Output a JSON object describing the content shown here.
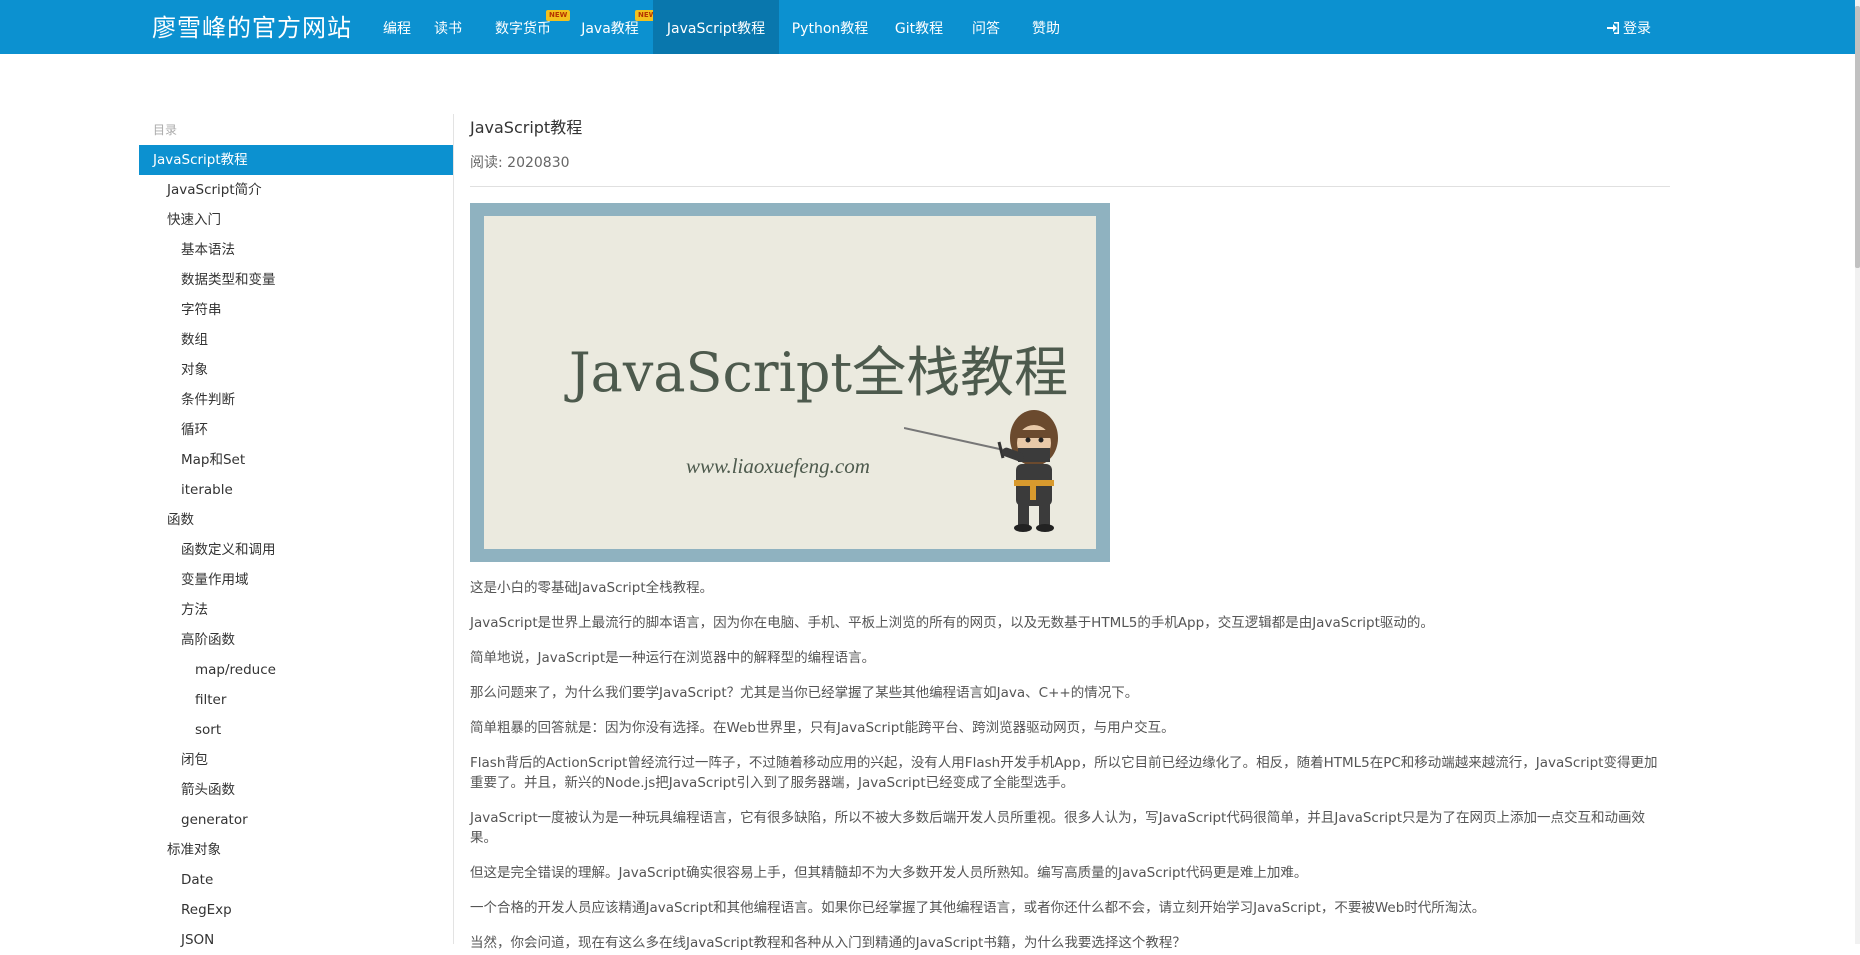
{
  "nav": {
    "brand": "廖雪峰的官方网站",
    "items": [
      {
        "label": "编程",
        "badge": ""
      },
      {
        "label": "读书",
        "badge": ""
      },
      {
        "label": "数字货币",
        "badge": "NEW"
      },
      {
        "label": "Java教程",
        "badge": "NEW"
      },
      {
        "label": "JavaScript教程",
        "badge": ""
      },
      {
        "label": "Python教程",
        "badge": ""
      },
      {
        "label": "Git教程",
        "badge": ""
      },
      {
        "label": "问答",
        "badge": ""
      },
      {
        "label": "赞助",
        "badge": ""
      }
    ],
    "active_item": "JavaScript教程",
    "login_label": "登录",
    "login_icon": "sign-in-icon"
  },
  "sidebar": {
    "header": "目录",
    "items": [
      {
        "label": "JavaScript教程",
        "level": 0,
        "active": true
      },
      {
        "label": "JavaScript简介",
        "level": 1
      },
      {
        "label": "快速入门",
        "level": 1
      },
      {
        "label": "基本语法",
        "level": 2
      },
      {
        "label": "数据类型和变量",
        "level": 2
      },
      {
        "label": "字符串",
        "level": 2
      },
      {
        "label": "数组",
        "level": 2
      },
      {
        "label": "对象",
        "level": 2
      },
      {
        "label": "条件判断",
        "level": 2
      },
      {
        "label": "循环",
        "level": 2
      },
      {
        "label": "Map和Set",
        "level": 2
      },
      {
        "label": "iterable",
        "level": 2
      },
      {
        "label": "函数",
        "level": 1
      },
      {
        "label": "函数定义和调用",
        "level": 2
      },
      {
        "label": "变量作用域",
        "level": 2
      },
      {
        "label": "方法",
        "level": 2
      },
      {
        "label": "高阶函数",
        "level": 2
      },
      {
        "label": "map/reduce",
        "level": 3
      },
      {
        "label": "filter",
        "level": 3
      },
      {
        "label": "sort",
        "level": 3
      },
      {
        "label": "闭包",
        "level": 2
      },
      {
        "label": "箭头函数",
        "level": 2
      },
      {
        "label": "generator",
        "level": 2
      },
      {
        "label": "标准对象",
        "level": 1
      },
      {
        "label": "Date",
        "level": 2
      },
      {
        "label": "RegExp",
        "level": 2
      },
      {
        "label": "JSON",
        "level": 2
      }
    ]
  },
  "article": {
    "title": "JavaScript教程",
    "read_count": "阅读: 2020830",
    "hero": {
      "title": "JavaScript全栈教程",
      "url": "www.liaoxuefeng.com",
      "colors": {
        "frame": "#8fb2c0",
        "paper": "#ebeadf"
      }
    },
    "paragraphs": [
      "这是小白的零基础JavaScript全栈教程。",
      "JavaScript是世界上最流行的脚本语言，因为你在电脑、手机、平板上浏览的所有的网页，以及无数基于HTML5的手机App，交互逻辑都是由JavaScript驱动的。",
      "简单地说，JavaScript是一种运行在浏览器中的解释型的编程语言。",
      "那么问题来了，为什么我们要学JavaScript？尤其是当你已经掌握了某些其他编程语言如Java、C++的情况下。",
      "简单粗暴的回答就是：因为你没有选择。在Web世界里，只有JavaScript能跨平台、跨浏览器驱动网页，与用户交互。",
      "Flash背后的ActionScript曾经流行过一阵子，不过随着移动应用的兴起，没有人用Flash开发手机App，所以它目前已经边缘化了。相反，随着HTML5在PC和移动端越来越流行，JavaScript变得更加重要了。并且，新兴的Node.js把JavaScript引入到了服务器端，JavaScript已经变成了全能型选手。",
      "JavaScript一度被认为是一种玩具编程语言，它有很多缺陷，所以不被大多数后端开发人员所重视。很多人认为，写JavaScript代码很简单，并且JavaScript只是为了在网页上添加一点交互和动画效果。",
      "但这是完全错误的理解。JavaScript确实很容易上手，但其精髓却不为大多数开发人员所熟知。编写高质量的JavaScript代码更是难上加难。",
      "一个合格的开发人员应该精通JavaScript和其他编程语言。如果你已经掌握了其他编程语言，或者你还什么都不会，请立刻开始学习JavaScript，不要被Web时代所淘汰。",
      "当然，你会问道，现在有这么多在线JavaScript教程和各种从入门到精通的JavaScript书籍，为什么我要选择这个教程？"
    ]
  },
  "colors": {
    "accent": "#0c91d0",
    "accent_dark": "#0977ad",
    "badge": "#f2c11d"
  }
}
